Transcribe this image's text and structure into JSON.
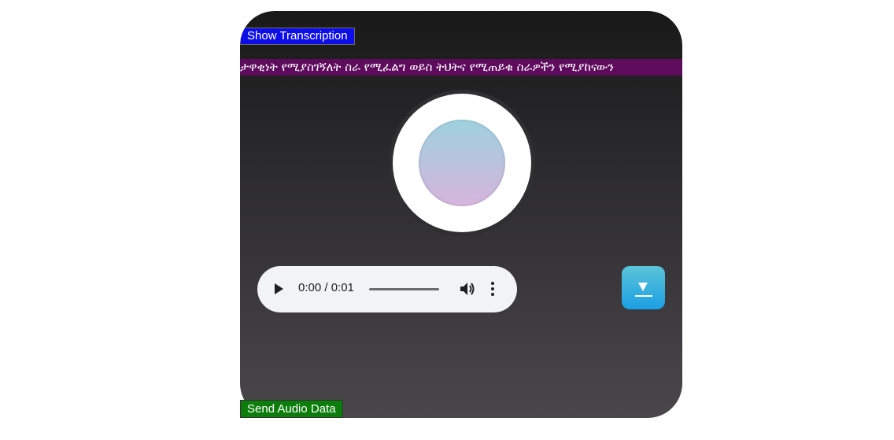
{
  "buttons": {
    "show_transcription": "Show Transcription",
    "send_audio": "Send Audio Data"
  },
  "marquee": {
    "text": "ታዋቂነት የሚያስገኝለት ስራ የሚፈልግ ወይስ ትህትና የሚጠይቁ ስራዎችን የሚያከናውን"
  },
  "audio": {
    "time": "0:00 / 0:01",
    "progress": 0
  },
  "icons": {
    "play": "play-icon",
    "volume": "volume-icon",
    "more": "more-vertical-icon",
    "download": "download-icon"
  },
  "colors": {
    "transcription_button": "#0d0de8",
    "send_button": "#0b7d0b",
    "marquee_bg": "#5e0b5e",
    "download_button": "#1b9fe4"
  }
}
